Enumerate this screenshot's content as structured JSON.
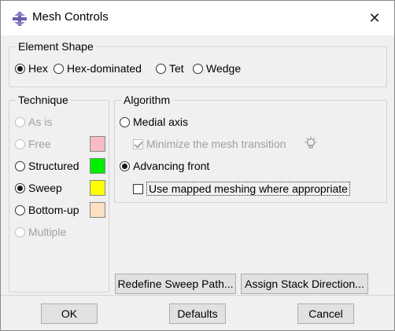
{
  "window": {
    "title": "Mesh Controls",
    "close_glyph": "✕",
    "icon": "mesh-controls-icon"
  },
  "element_shape": {
    "legend": "Element Shape",
    "options": [
      {
        "label": "Hex",
        "selected": true
      },
      {
        "label": "Hex-dominated",
        "selected": false
      },
      {
        "label": "Tet",
        "selected": false
      },
      {
        "label": "Wedge",
        "selected": false
      }
    ]
  },
  "technique": {
    "legend": "Technique",
    "options": [
      {
        "label": "As is",
        "selected": false,
        "enabled": false,
        "color": null
      },
      {
        "label": "Free",
        "selected": false,
        "enabled": false,
        "color": "#f8bcc8"
      },
      {
        "label": "Structured",
        "selected": false,
        "enabled": true,
        "color": "#00ee00"
      },
      {
        "label": "Sweep",
        "selected": true,
        "enabled": true,
        "color": "#ffff00"
      },
      {
        "label": "Bottom-up",
        "selected": false,
        "enabled": true,
        "color": "#fde0c0"
      },
      {
        "label": "Multiple",
        "selected": false,
        "enabled": false,
        "color": null
      }
    ]
  },
  "algorithm": {
    "legend": "Algorithm",
    "medial_axis": {
      "label": "Medial axis",
      "selected": false
    },
    "minimize_transition": {
      "label": "Minimize the mesh transition",
      "checked": true,
      "enabled": false
    },
    "advancing_front": {
      "label": "Advancing front",
      "selected": true
    },
    "mapped_meshing": {
      "label": "Use mapped meshing where appropriate",
      "checked": false,
      "enabled": true
    }
  },
  "actions": {
    "redefine_sweep_path": "Redefine Sweep Path...",
    "assign_stack_direction": "Assign Stack Direction..."
  },
  "footer": {
    "ok": "OK",
    "defaults": "Defaults",
    "cancel": "Cancel"
  }
}
